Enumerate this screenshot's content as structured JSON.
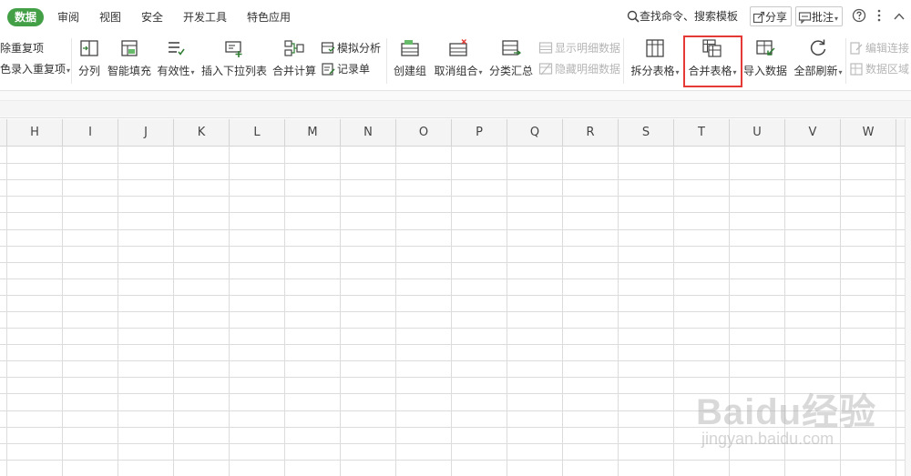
{
  "menu": {
    "tabs": [
      {
        "label": "数据",
        "active": true
      },
      {
        "label": "审阅"
      },
      {
        "label": "视图"
      },
      {
        "label": "安全"
      },
      {
        "label": "开发工具"
      },
      {
        "label": "特色应用"
      }
    ],
    "search_label": "查找命令、搜索模板",
    "share_label": "分享",
    "comment_label": "批注",
    "help_icon": "help-icon",
    "more_icon": "more-icon",
    "collapse_icon": "chevron-up-icon"
  },
  "ribbon": {
    "dup_highlight_label": "除重复项",
    "dup_reject_label": "色录入重复项",
    "split_column_label": "分列",
    "smart_fill_label": "智能填充",
    "validity_label": "有效性",
    "insert_dropdown_label": "插入下拉列表",
    "merge_calc_label": "合并计算",
    "simulate_label": "模拟分析",
    "record_label": "记录单",
    "create_group_label": "创建组",
    "ungroup_label": "取消组合",
    "subtotal_label": "分类汇总",
    "show_detail_label": "显示明细数据",
    "hide_detail_label": "隐藏明细数据",
    "split_table_label": "拆分表格",
    "merge_table_label": "合并表格",
    "import_data_label": "导入数据",
    "refresh_all_label": "全部刷新",
    "edit_links_label": "编辑连接",
    "data_region_label": "数据区域",
    "accent_color": "#43a047",
    "highlight_color": "#e53935"
  },
  "sheet": {
    "columns": [
      "H",
      "I",
      "J",
      "K",
      "L",
      "M",
      "N",
      "O",
      "P",
      "Q",
      "R",
      "S",
      "T",
      "U",
      "V",
      "W"
    ]
  },
  "watermark": {
    "main": "Baidu经验",
    "sub": "jingyan.baidu.com"
  }
}
